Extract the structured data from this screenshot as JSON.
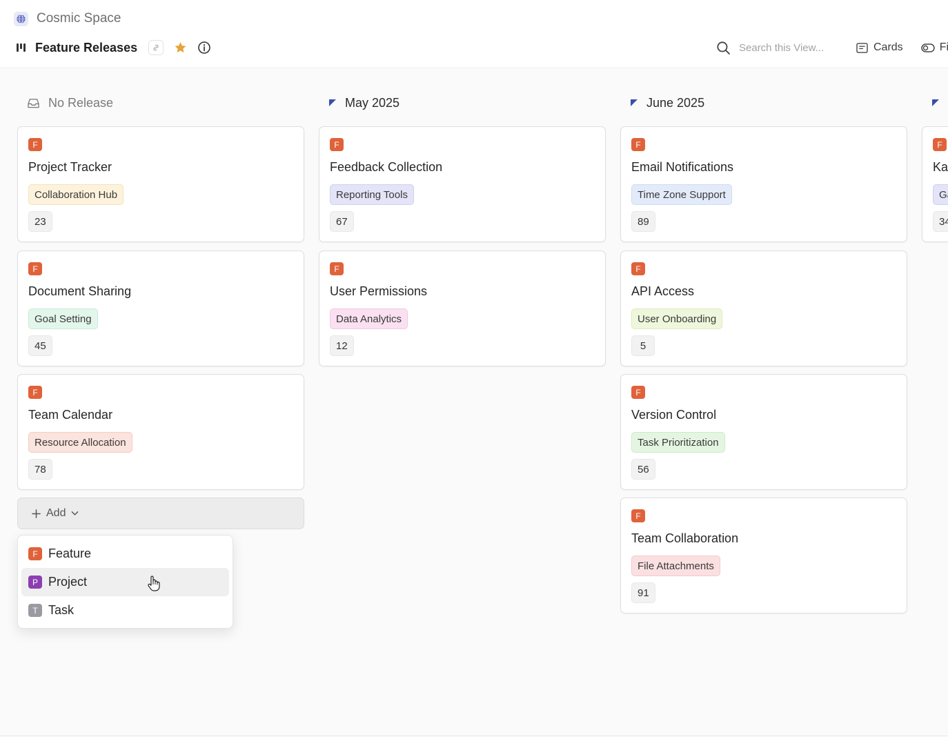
{
  "header": {
    "space_name": "Cosmic Space",
    "view_title": "Feature Releases",
    "search_placeholder": "Search this View...",
    "cards_label": "Cards",
    "filter_label": "Fi"
  },
  "colors": {
    "feature_badge": "#e0623a",
    "project_badge": "#8b3fb2",
    "task_badge": "#9a9aa2",
    "star": "#e8a33a",
    "release_flag": "#3b4fa8"
  },
  "columns": [
    {
      "title": "No Release",
      "cards": [
        {
          "badge": "F",
          "title": "Project Tracker",
          "tag": "Collaboration Hub",
          "tag_bg": "#fdf2dc",
          "tag_border": "#f3e2bc",
          "count": "23"
        },
        {
          "badge": "F",
          "title": "Document Sharing",
          "tag": "Goal Setting",
          "tag_bg": "#e3f6ec",
          "tag_border": "#c9ebd8",
          "count": "45"
        },
        {
          "badge": "F",
          "title": "Team Calendar",
          "tag": "Resource Allocation",
          "tag_bg": "#fbe3de",
          "tag_border": "#f3cdc5",
          "count": "78"
        }
      ]
    },
    {
      "title": "May 2025",
      "cards": [
        {
          "badge": "F",
          "title": "Feedback Collection",
          "tag": "Reporting Tools",
          "tag_bg": "#e3e4f7",
          "tag_border": "#cfd1ee",
          "count": "67"
        },
        {
          "badge": "F",
          "title": "User Permissions",
          "tag": "Data Analytics",
          "tag_bg": "#fae0f1",
          "tag_border": "#f1c9e4",
          "count": "12"
        }
      ]
    },
    {
      "title": "June 2025",
      "cards": [
        {
          "badge": "F",
          "title": "Email Notifications",
          "tag": "Time Zone Support",
          "tag_bg": "#e3ebfa",
          "tag_border": "#cddbf2",
          "count": "89"
        },
        {
          "badge": "F",
          "title": "API Access",
          "tag": "User Onboarding",
          "tag_bg": "#eef7dc",
          "tag_border": "#dcecbd",
          "count": "5"
        },
        {
          "badge": "F",
          "title": "Version Control",
          "tag": "Task Prioritization",
          "tag_bg": "#e4f6e2",
          "tag_border": "#cdebc9",
          "count": "56"
        },
        {
          "badge": "F",
          "title": "Team Collaboration",
          "tag": "File Attachments",
          "tag_bg": "#fbe0e2",
          "tag_border": "#f3c9cd",
          "count": "91"
        }
      ]
    },
    {
      "title": "",
      "cards": [
        {
          "badge": "F",
          "title": "Ka",
          "tag": "Ga",
          "tag_bg": "#e3e4f7",
          "tag_border": "#cfd1ee",
          "count": "34"
        }
      ]
    }
  ],
  "add_button": {
    "label": "Add"
  },
  "add_menu": [
    {
      "badge": "F",
      "label": "Feature"
    },
    {
      "badge": "P",
      "label": "Project"
    },
    {
      "badge": "T",
      "label": "Task"
    }
  ]
}
